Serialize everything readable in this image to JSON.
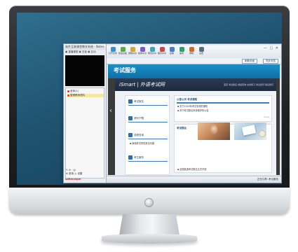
{
  "left_pane": {
    "title": "软件互联课堂教学系统 - Notes",
    "menu": "▣ 直播课堂  ▣ 白板  ▣ 互动",
    "users": [
      {
        "name": "老师(1)",
        "color": "#d23b3b",
        "selected": false
      },
      {
        "name": "整理教师资料",
        "color": "#d23b3b",
        "selected": true
      }
    ],
    "toolbar_top": "✎  ✉ ·  ☺",
    "toolbar_bottom": "⊕ 邀请 ◎ 设置",
    "brand": "softmanger"
  },
  "right_pane": {
    "window_controls": "— ▢ ✕",
    "ribbon": [
      {
        "label": "打开文件",
        "color": "#3a8fd0"
      },
      {
        "label": "新建白板",
        "color": "#5aa84a"
      },
      {
        "label": "屏幕共享",
        "color": "#d8a23a"
      },
      {
        "label": "媒体共享",
        "color": "#7b5cc4"
      },
      {
        "label": "网页共享",
        "color": "#3aa6b8"
      },
      {
        "label": "程序共享",
        "color": "#c24b4b"
      },
      {
        "label": "投票",
        "color": "#4a7cc9"
      },
      {
        "label": "提问",
        "color": "#2f9e6d"
      },
      {
        "label": "录制",
        "color": "#cc6a2a"
      },
      {
        "label": "设置",
        "color": "#5a6b80"
      }
    ],
    "addr_buttons": [
      "刷新页面",
      "同步浏览"
    ],
    "statusbar": "正在共享: 考试服务",
    "bottom_tabs": [
      "文档",
      "白板",
      "网页",
      "互联网浏览"
    ]
  },
  "slide": {
    "header_title": "考试服务",
    "site_logo": "iSmart | 外语考试网",
    "site_links": "首页   考试报名   成绩查询   在线练习   考试资讯   联系我们",
    "left_items": [
      "考试报名",
      "资料下载",
      "成绩查询",
      "考生服务"
    ],
    "left_news": "▪ 网络考试须知常见问题",
    "notice_title": "公告公示    考试通知",
    "notice_items": [
      "▪ 关于2020年考试安排的通知",
      "▪ 关于考试报名系统维护的公告"
    ],
    "section2_title": "考试报名",
    "more": "more",
    "footer_news": "▪ 全国英语考试报名正式开放"
  }
}
